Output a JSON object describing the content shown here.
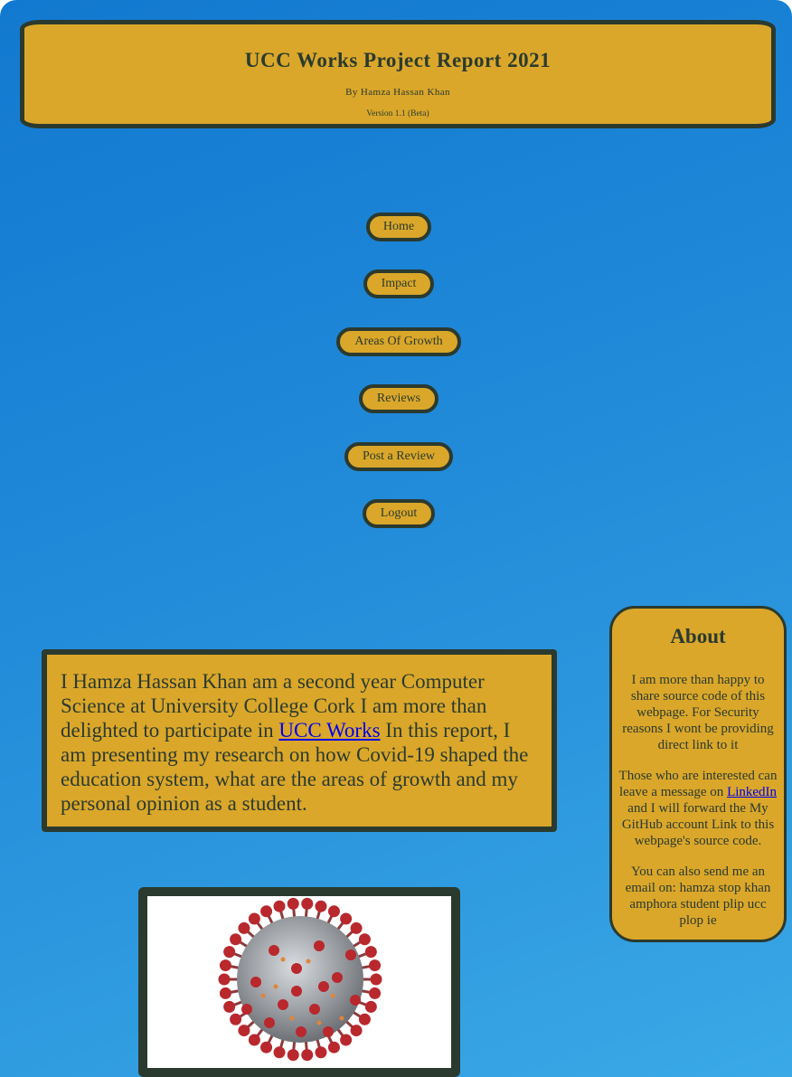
{
  "header": {
    "title": "UCC Works Project Report 2021",
    "byline": "By Hamza Hassan Khan",
    "version": "Version 1.1 (Beta)"
  },
  "nav": {
    "home": "Home",
    "impact": "Impact",
    "areas": "Areas Of Growth",
    "reviews": "Reviews",
    "post_review": "Post a Review",
    "logout": "Logout"
  },
  "about": {
    "title": "About",
    "p1": "I am more than happy to share source code of this webpage. For Security reasons I wont be providing direct link to it",
    "p2_before": "Those who are interested can leave a message on ",
    "p2_link": "LinkedIn",
    "p2_after": " and I will forward the My GitHub account Link to this webpage's source code.",
    "p3": "You can also send me an email on: hamza stop khan amphora student plip ucc plop ie"
  },
  "intro": {
    "before": "I Hamza Hassan Khan am a second year Computer Science at University College Cork I am more than delighted to participate in ",
    "link": "UCC Works",
    "after": " In this report, I am presenting my research on how Covid-19 shaped the education system, what are the areas of growth and my personal opinion as a student."
  },
  "colors": {
    "panel": "#daa72a",
    "border": "#2b3a2f",
    "background": "#1f88d8",
    "virus_red": "#b8282d",
    "virus_gray": "#9a9ea3"
  }
}
